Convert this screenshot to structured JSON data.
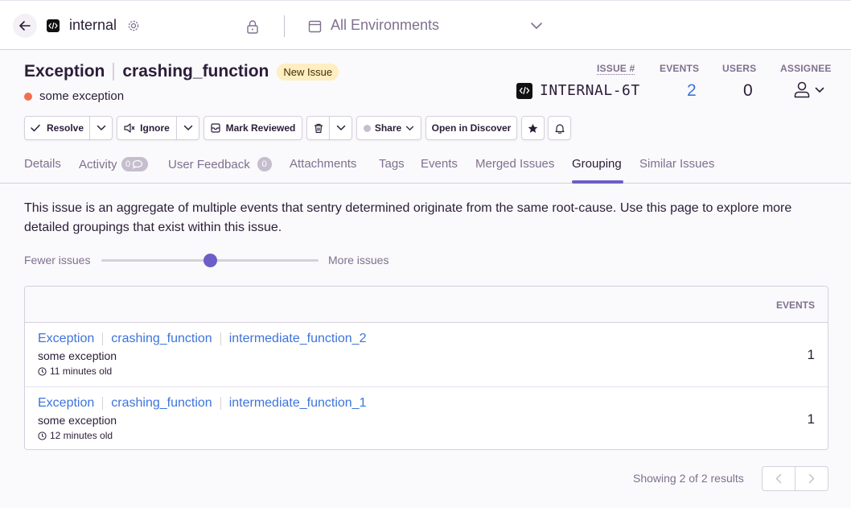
{
  "topbar": {
    "project_name": "internal",
    "environment": "All Environments"
  },
  "issue": {
    "type": "Exception",
    "function": "crashing_function",
    "badge": "New Issue",
    "message": "some exception",
    "level_color": "#f36e4f",
    "short_id": "INTERNAL-6T",
    "stats": {
      "issue_num_label": "ISSUE #",
      "events_label": "EVENTS",
      "users_label": "USERS",
      "assignee_label": "ASSIGNEE",
      "events": "2",
      "users": "0"
    }
  },
  "actions": {
    "resolve": "Resolve",
    "ignore": "Ignore",
    "mark_reviewed": "Mark Reviewed",
    "share": "Share",
    "open_discover": "Open in Discover"
  },
  "tabs": [
    {
      "label": "Details"
    },
    {
      "label": "Activity",
      "badge": "0"
    },
    {
      "label": "User Feedback",
      "badge": "0"
    },
    {
      "label": "Attachments"
    },
    {
      "label": "Tags"
    },
    {
      "label": "Events"
    },
    {
      "label": "Merged Issues"
    },
    {
      "label": "Grouping",
      "active": true
    },
    {
      "label": "Similar Issues"
    }
  ],
  "grouping": {
    "intro": "This issue is an aggregate of multiple events that sentry determined originate from the same root-cause. Use this page to explore more detailed groupings that exist within this issue.",
    "slider_fewer": "Fewer issues",
    "slider_more": "More issues",
    "slider_level": 0.5,
    "events_header": "EVENTS",
    "rows": [
      {
        "type": "Exception",
        "function": "crashing_function",
        "sub": "intermediate_function_2",
        "message": "some exception",
        "age": "11 minutes old",
        "count": "1"
      },
      {
        "type": "Exception",
        "function": "crashing_function",
        "sub": "intermediate_function_1",
        "message": "some exception",
        "age": "12 minutes old",
        "count": "1"
      }
    ],
    "pagination_text": "Showing 2 of 2 results"
  },
  "colors": {
    "accent": "#6c5fc7",
    "link": "#3d74db",
    "badge_bg": "#ffeec2"
  }
}
